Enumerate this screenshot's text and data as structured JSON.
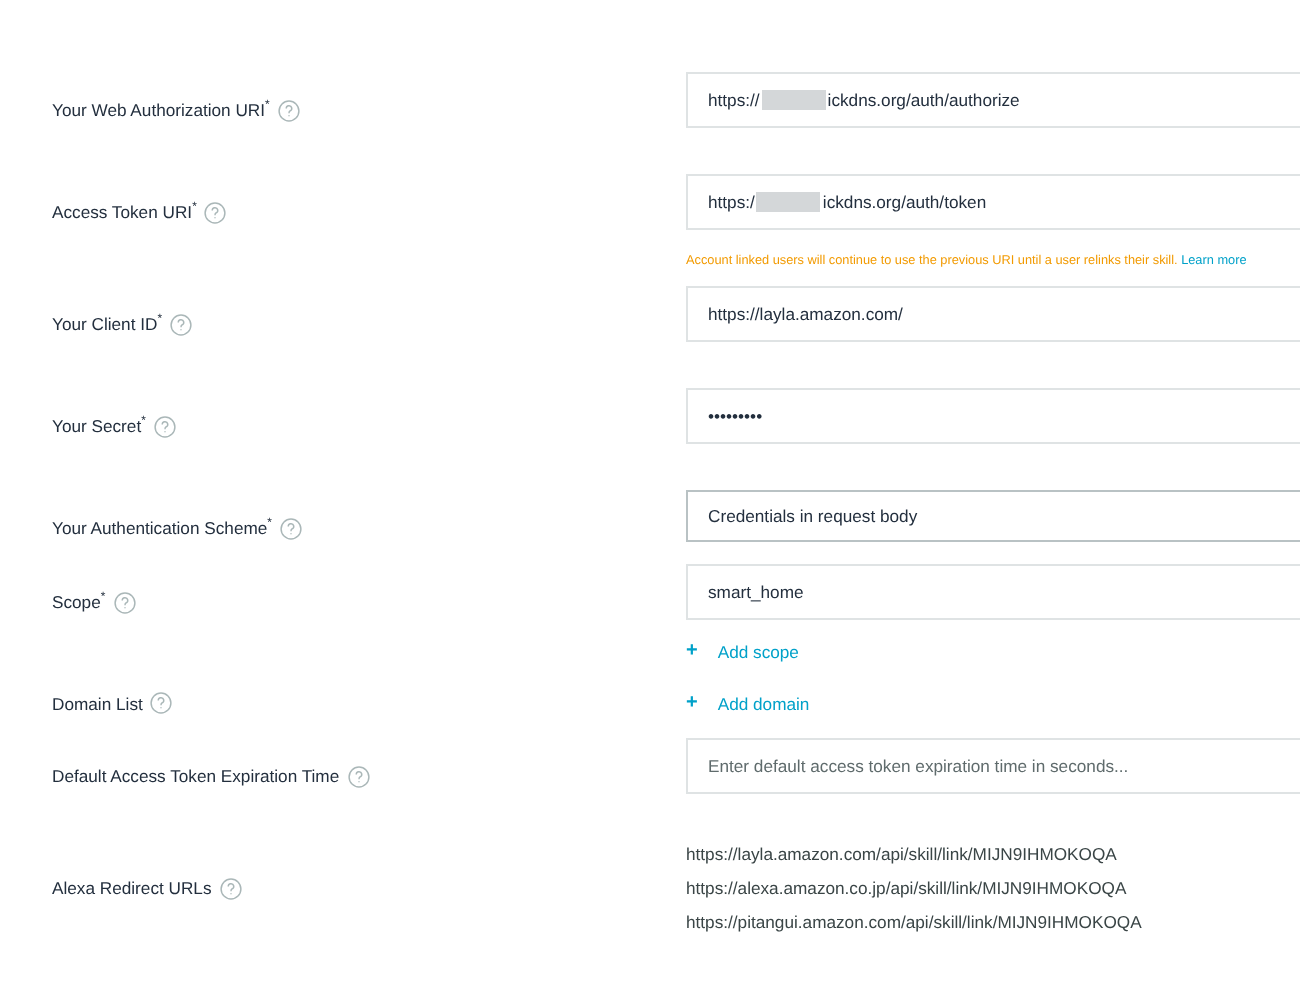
{
  "rows": [
    {
      "label": "Your Web Authorization URI$^{*}$",
      "kind": "field",
      "value_start": "https://",
      "redacted": true,
      "value_end": "ickdns.org/auth/authorize"
    },
    {
      "label": "Access Token URI$^{*}$",
      "kind": "field",
      "value_start": "https:/",
      "redacted": true,
      "value_end": "ickdns.org/auth/token",
      "note": "Account linked users will continue to use the previous URI until a user relinks their skill.",
      "note_link": "Learn more"
    },
    {
      "label": "Your Client ID$^{*}$",
      "kind": "field",
      "value_start": "https://layla.amazon.com/"
    },
    {
      "label": "Your Secret$^{*}$",
      "kind": "field",
      "value_start": "•••••••••"
    },
    {
      "label": "Your Authentication Scheme$^{*}$",
      "kind": "select",
      "value_start": "Credentials in request body"
    },
    {
      "label": "Scope$^{*}$",
      "kind": "field",
      "value_start": "smart_home",
      "add": "Add scope",
      "add_icon": "+"
    },
    {
      "label": "Domain List",
      "kind": "add",
      "add": "Add domain",
      "add_icon": "+"
    },
    {
      "label": "Default Access Token Expiration Time",
      "kind": "input",
      "placeholder": "Enter default access token expiration time in seconds..."
    },
    {
      "label": "Alexa Redirect URLs",
      "kind": "urls",
      "urls": [
        "https://layla.amazon.com/api/skill/link/MIJN9IHMOKOQA",
        "https://alexa.amazon.co.jp/api/skill/link/MIJN9IHMOKOQA",
        "https://pitangui.amazon.com/api/skill/link/MIJN9IHMOKOQA"
      ]
    }
  ]
}
